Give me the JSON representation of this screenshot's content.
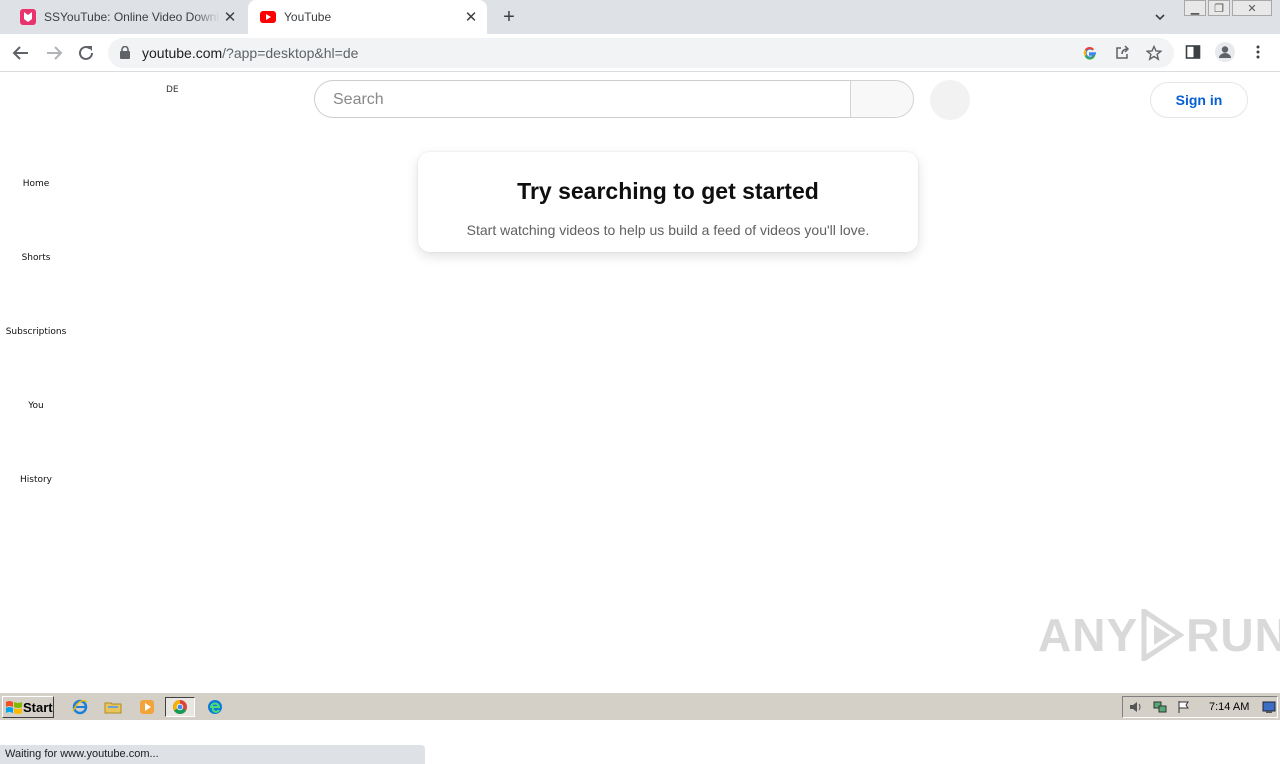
{
  "browser": {
    "tabs": [
      {
        "title": "SSYouTube: Online Video Downloader",
        "active": false
      },
      {
        "title": "YouTube",
        "active": true
      }
    ],
    "new_tab_label": "+",
    "url_host": "youtube.com",
    "url_rest": "/?app=desktop&hl=de",
    "status_text": "Waiting for www.youtube.com..."
  },
  "page": {
    "country_code": "DE",
    "search_placeholder": "Search",
    "sign_in_label": "Sign in",
    "guide": [
      "Home",
      "Shorts",
      "Subscriptions",
      "You",
      "History"
    ],
    "card_title": "Try searching to get started",
    "card_body": "Start watching videos to help us build a feed of videos you'll love."
  },
  "watermark": {
    "left": "ANY",
    "right": "RUN"
  },
  "taskbar": {
    "start_label": "Start",
    "clock": "7:14 AM"
  },
  "colors": {
    "accent": "#065fd4",
    "youtube_red": "#ff0000",
    "ssyoutube_pink": "#e9336d"
  }
}
